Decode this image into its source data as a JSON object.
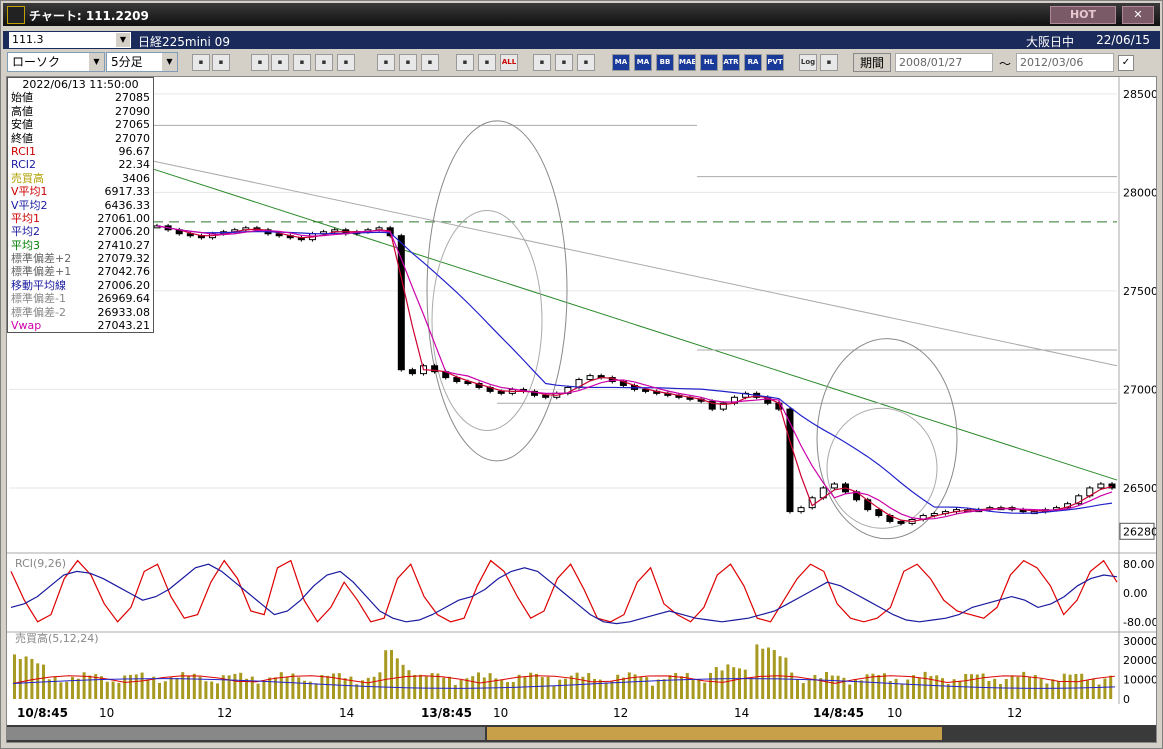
{
  "window": {
    "title": "チャート: 111.2209",
    "hot_label": "HOT",
    "close_label": "✕"
  },
  "info": {
    "code": "111.3",
    "name": "日経225mini 09",
    "market": "大阪日中",
    "date": "22/06/15"
  },
  "toolbar": {
    "chart_type": "ローソク",
    "interval": "5分足",
    "buttons": [
      "search",
      "crosshair",
      "bullseye",
      "zoom",
      "bars",
      "flags",
      "alert",
      "pencil",
      "cursor",
      "arrow",
      "lines-red",
      "lines-blue",
      "ALL",
      "gear",
      "paint",
      "palette",
      "MA",
      "MA",
      "BB",
      "MAE",
      "HL",
      "ATR",
      "RA",
      "PVT",
      "Log",
      "export"
    ],
    "period_label": "期間",
    "from_date": "2008/01/27",
    "tilde": "～",
    "to_date": "2012/03/06"
  },
  "info_panel": {
    "timestamp": "2022/06/13  11:50:00",
    "rows": [
      {
        "label": "始値",
        "value": "27085",
        "color": "#000000"
      },
      {
        "label": "高値",
        "value": "27090",
        "color": "#000000"
      },
      {
        "label": "安値",
        "value": "27065",
        "color": "#000000"
      },
      {
        "label": "終値",
        "value": "27070",
        "color": "#000000"
      },
      {
        "label": "RCI1",
        "value": "96.67",
        "color": "#cc0000"
      },
      {
        "label": "RCI2",
        "value": "22.34",
        "color": "#1a1aa0"
      },
      {
        "label": "売買高",
        "value": "3406",
        "color": "#b0a000"
      },
      {
        "label": "V平均1",
        "value": "6917.33",
        "color": "#cc0000"
      },
      {
        "label": "V平均2",
        "value": "6436.33",
        "color": "#1a1aa0"
      },
      {
        "label": "平均1",
        "value": "27061.00",
        "color": "#cc0000"
      },
      {
        "label": "平均2",
        "value": "27006.20",
        "color": "#1a1aa0"
      },
      {
        "label": "平均3",
        "value": "27410.27",
        "color": "#008000"
      },
      {
        "label": "標準偏差+2",
        "value": "27079.32",
        "color": "#666666"
      },
      {
        "label": "標準偏差+1",
        "value": "27042.76",
        "color": "#666666"
      },
      {
        "label": "移動平均線",
        "value": "27006.20",
        "color": "#1a1aa0"
      },
      {
        "label": "標準偏差-1",
        "value": "26969.64",
        "color": "#888888"
      },
      {
        "label": "標準偏差-2",
        "value": "26933.08",
        "color": "#888888"
      },
      {
        "label": "Vwap",
        "value": "27043.21",
        "color": "#cc00aa"
      }
    ]
  },
  "chart_data": [
    {
      "type": "candlestick",
      "price_axis": {
        "ticks": [
          28500,
          28000,
          27500,
          27000,
          26500
        ],
        "range": [
          26180,
          28560
        ],
        "current_price_label": "26280",
        "dashed_level": 27850
      },
      "x_ticks": [
        "10/8:45",
        "10",
        "12",
        "14",
        "13/8:45",
        "10",
        "12",
        "14",
        "14/8:45",
        "10",
        "12"
      ],
      "close_series": [
        27830,
        27810,
        27790,
        27780,
        27770,
        27790,
        27800,
        27810,
        27820,
        27810,
        27790,
        27780,
        27770,
        27760,
        27790,
        27800,
        27810,
        27790,
        27800,
        27810,
        27820,
        27780,
        27100,
        27080,
        27120,
        27090,
        27060,
        27040,
        27030,
        27010,
        26990,
        26980,
        27000,
        26990,
        26970,
        26960,
        26980,
        27010,
        27050,
        27070,
        27060,
        27040,
        27020,
        27000,
        26990,
        26980,
        26970,
        26960,
        26950,
        26940,
        26900,
        26930,
        26960,
        26980,
        26960,
        26930,
        26900,
        26380,
        26400,
        26450,
        26500,
        26520,
        26480,
        26440,
        26390,
        26360,
        26330,
        26320,
        26340,
        26360,
        26370,
        26380,
        26390,
        26390,
        26390,
        26400,
        26400,
        26390,
        26380,
        26380,
        26390,
        26400,
        26420,
        26460,
        26500,
        26520,
        26500
      ],
      "moving_averages": [
        {
          "name": "平均1",
          "color": "#cc0033"
        },
        {
          "name": "平均2",
          "color": "#2222cc"
        },
        {
          "name": "平均3",
          "color": "#228822"
        },
        {
          "name": "Vwap",
          "color": "#cc00aa"
        }
      ]
    },
    {
      "type": "line",
      "title": "RCI(9,26)",
      "ticks": [
        "80.00",
        "0.00",
        "-80.00"
      ],
      "series": [
        {
          "name": "RCI1",
          "color": "#dd0000",
          "values": [
            60,
            -20,
            -80,
            -60,
            40,
            90,
            50,
            -30,
            -80,
            -40,
            60,
            80,
            -10,
            -70,
            -60,
            30,
            90,
            40,
            -50,
            -60,
            70,
            90,
            -20,
            -80,
            -40,
            30,
            -20,
            -80,
            -70,
            40,
            80,
            -10,
            -60,
            -80,
            -70,
            20,
            90,
            60,
            -10,
            -70,
            -50,
            40,
            80,
            10,
            -70,
            -80,
            -60,
            30,
            70,
            -30,
            -60,
            -80,
            -40,
            50,
            80,
            20,
            -70,
            -80,
            -20,
            40,
            80,
            60,
            -30,
            -70,
            -80,
            -70,
            -40,
            60,
            80,
            40,
            -20,
            -50,
            -60,
            -70,
            -40,
            50,
            90,
            70,
            20,
            -60,
            -20,
            60,
            90,
            30
          ]
        },
        {
          "name": "RCI2",
          "color": "#1a1aa0",
          "values": [
            -40,
            -30,
            -10,
            20,
            50,
            60,
            55,
            40,
            20,
            0,
            -20,
            -10,
            10,
            40,
            70,
            80,
            60,
            30,
            0,
            -30,
            -60,
            -50,
            -20,
            20,
            50,
            60,
            30,
            -10,
            -50,
            -70,
            -80,
            -75,
            -60,
            -40,
            -20,
            -10,
            10,
            40,
            60,
            70,
            60,
            30,
            0,
            -30,
            -60,
            -80,
            -85,
            -80,
            -70,
            -60,
            -50,
            -60,
            -70,
            -75,
            -80,
            -75,
            -70,
            -60,
            -50,
            -30,
            -10,
            10,
            30,
            20,
            0,
            -20,
            -40,
            -60,
            -75,
            -80,
            -75,
            -70,
            -60,
            -40,
            -30,
            -20,
            -10,
            -20,
            -40,
            -30,
            -10,
            20,
            40,
            50,
            45
          ]
        }
      ]
    },
    {
      "type": "bar",
      "title": "売買高(5,12,24)",
      "ticks": [
        "30000",
        "20000",
        "10000",
        "0"
      ]
    }
  ]
}
